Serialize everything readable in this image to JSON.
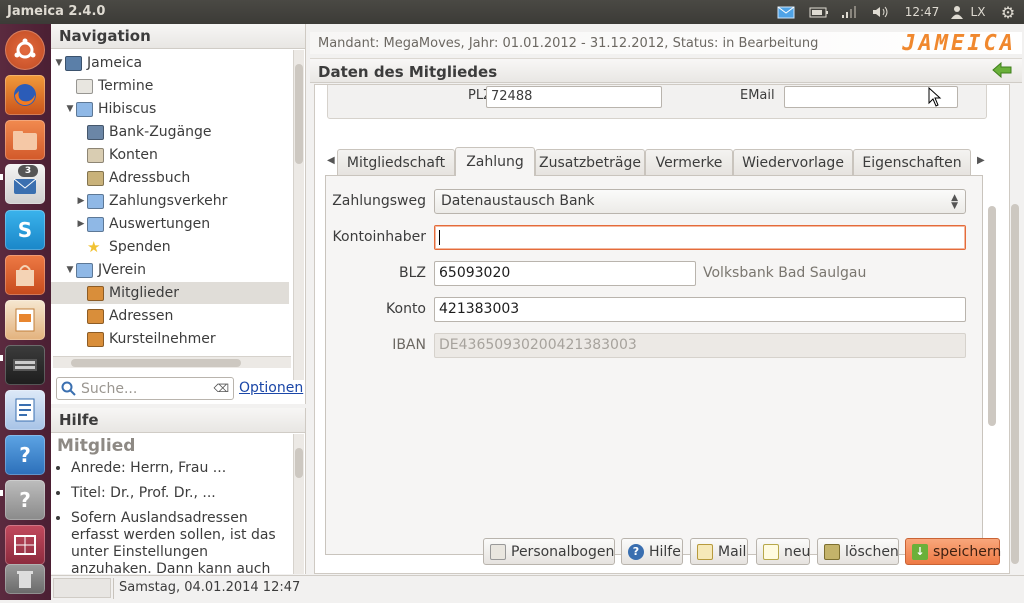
{
  "topbar": {
    "app_title": "Jameica 2.4.0",
    "time": "12:47",
    "keyboard": "LX"
  },
  "launcher": {
    "badge": "3",
    "colors": {
      "bg": "#4b1f33"
    }
  },
  "nav": {
    "title": "Navigation",
    "items": [
      {
        "label": "Jameica",
        "level": 0,
        "expanded": true,
        "icon": "computer-icon"
      },
      {
        "label": "Termine",
        "level": 1,
        "icon": "calendar-icon"
      },
      {
        "label": "Hibiscus",
        "level": 1,
        "expanded": true,
        "icon": "folder-icon"
      },
      {
        "label": "Bank-Zugänge",
        "level": 2,
        "icon": "tools-icon"
      },
      {
        "label": "Konten",
        "level": 2,
        "icon": "account-icon"
      },
      {
        "label": "Adressbuch",
        "level": 2,
        "icon": "address-book-icon"
      },
      {
        "label": "Zahlungsverkehr",
        "level": 2,
        "collapsed": true,
        "icon": "folder-icon"
      },
      {
        "label": "Auswertungen",
        "level": 2,
        "collapsed": true,
        "icon": "folder-icon"
      },
      {
        "label": "Spenden",
        "level": 2,
        "icon": "star-icon"
      },
      {
        "label": "JVerein",
        "level": 1,
        "expanded": true,
        "icon": "folder-icon"
      },
      {
        "label": "Mitglieder",
        "level": 2,
        "selected": true,
        "icon": "members-icon"
      },
      {
        "label": "Adressen",
        "level": 2,
        "icon": "members-icon"
      },
      {
        "label": "Kursteilnehmer",
        "level": 2,
        "icon": "members-icon"
      }
    ],
    "search_placeholder": "Suche...",
    "options_link": "Optionen"
  },
  "help": {
    "title": "Hilfe",
    "heading": "Mitglied",
    "items": [
      "Anrede: Herrn, Frau ...",
      "Titel: Dr., Prof. Dr., ...",
      "Sofern Auslandsadressen erfasst werden sollen, ist das unter Einstellungen anzuhaken. Dann kann auch der"
    ]
  },
  "status": {
    "datetime": "Samstag, 04.01.2014 12:47"
  },
  "header": {
    "mandant": "Mandant: MegaMoves, Jahr: 01.01.2012 - 31.12.2012, Status: in Bearbeitung",
    "logo": "JAMEICA",
    "section_title": "Daten des Mitgliedes"
  },
  "contact": {
    "plz_label": "PLZ",
    "plz_value": "72488",
    "email_label": "EMail",
    "email_value": ""
  },
  "tabs": [
    "Mitgliedschaft",
    "Zahlung",
    "Zusatzbeträge",
    "Vermerke",
    "Wiedervorlage",
    "Eigenschaften"
  ],
  "active_tab": "Zahlung",
  "form": {
    "zahlungsweg_label": "Zahlungsweg",
    "zahlungsweg_value": "Datenaustausch Bank",
    "kontoinhaber_label": "Kontoinhaber",
    "kontoinhaber_value": "",
    "blz_label": "BLZ",
    "blz_value": "65093020",
    "bank_name": "Volksbank Bad Saulgau",
    "konto_label": "Konto",
    "konto_value": "421383003",
    "iban_label": "IBAN",
    "iban_value": "DE43650930200421383003"
  },
  "buttons": {
    "personalbogen": "Personalbogen",
    "hilfe": "Hilfe",
    "mail": "Mail",
    "neu": "neu",
    "loeschen": "löschen",
    "speichern": "speichern"
  },
  "colors": {
    "accent": "#f0882e",
    "focus": "#e46b3a",
    "primary_button": "#ee7a45"
  }
}
